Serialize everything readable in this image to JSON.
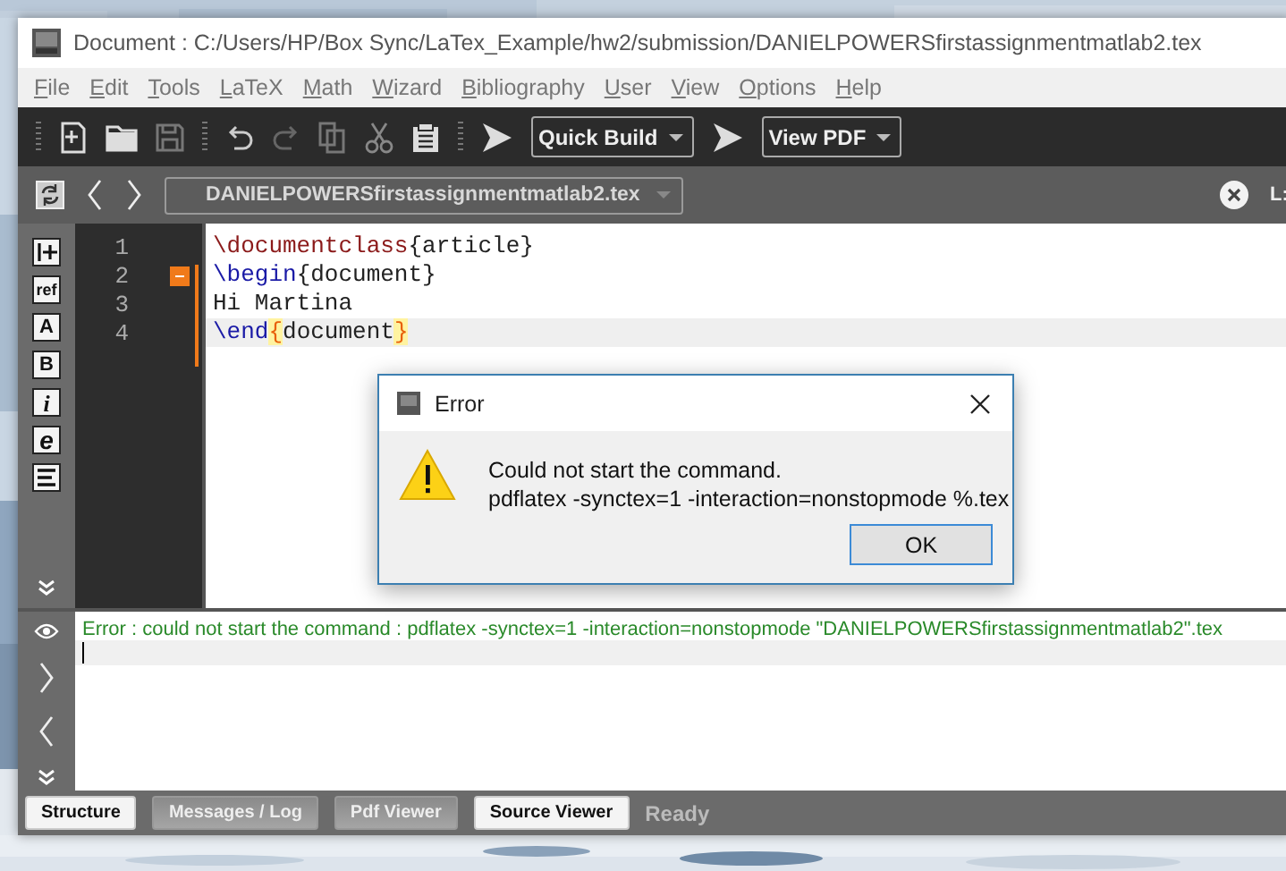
{
  "window": {
    "title": "Document : C:/Users/HP/Box Sync/LaTex_Example/hw2/submission/DANIELPOWERSfirstassignmentmatlab2.tex"
  },
  "menu": [
    "File",
    "Edit",
    "Tools",
    "LaTeX",
    "Math",
    "Wizard",
    "Bibliography",
    "User",
    "View",
    "Options",
    "Help"
  ],
  "toolbar": {
    "build_tool": "Quick Build",
    "view_tool": "View PDF"
  },
  "tab_bar": {
    "file": "DANIELPOWERSfirstassignmentmatlab2.tex",
    "cursor_label": "L:"
  },
  "structure_tools": [
    "ref",
    "A",
    "B",
    "i",
    "e"
  ],
  "editor": {
    "lines": [
      {
        "number": "1",
        "current": false,
        "fold": false,
        "tokens": [
          {
            "kind": "command",
            "text": "\\documentclass"
          },
          {
            "kind": "text",
            "text": "{article}"
          }
        ]
      },
      {
        "number": "2",
        "current": false,
        "fold": true,
        "tokens": [
          {
            "kind": "keyword",
            "text": "\\begin"
          },
          {
            "kind": "text",
            "text": "{document}"
          }
        ]
      },
      {
        "number": "3",
        "current": false,
        "fold": false,
        "tokens": [
          {
            "kind": "text",
            "text": "Hi Martina"
          }
        ]
      },
      {
        "number": "4",
        "current": true,
        "fold": false,
        "tokens": [
          {
            "kind": "keyword",
            "text": "\\end"
          },
          {
            "kind": "match",
            "text": "{"
          },
          {
            "kind": "text",
            "text": "document"
          },
          {
            "kind": "match",
            "text": "}"
          }
        ]
      }
    ]
  },
  "log_panel": {
    "message": "Error : could not start the command : pdflatex -synctex=1 -interaction=nonstopmode \"DANIELPOWERSfirstassignmentmatlab2\".tex"
  },
  "status_bar": {
    "panels": [
      {
        "label": "Structure",
        "checked": false
      },
      {
        "label": "Messages / Log",
        "checked": true
      },
      {
        "label": "Pdf Viewer",
        "checked": true
      },
      {
        "label": "Source Viewer",
        "checked": false
      }
    ],
    "status": "Ready"
  },
  "dialog": {
    "title": "Error",
    "message": [
      "Could not start the command.",
      "pdflatex -synctex=1 -interaction=nonstopmode %.tex"
    ],
    "button": "OK"
  }
}
